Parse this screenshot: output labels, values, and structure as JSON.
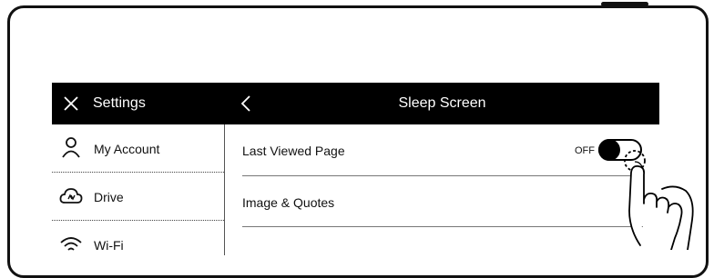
{
  "header": {
    "settings_title": "Settings",
    "page_title": "Sleep Screen"
  },
  "sidebar": {
    "items": [
      {
        "label": "My Account",
        "icon": "person-icon"
      },
      {
        "label": "Drive",
        "icon": "cloud-sync-icon"
      },
      {
        "label": "Wi-Fi",
        "icon": "wifi-icon"
      }
    ]
  },
  "content": {
    "rows": [
      {
        "label": "Last Viewed Page",
        "toggle_state_text": "OFF",
        "toggle_on": false
      },
      {
        "label": "Image & Quotes"
      }
    ]
  },
  "colors": {
    "header_bg": "#000000",
    "header_text": "#ffffff",
    "body_text": "#111111"
  }
}
